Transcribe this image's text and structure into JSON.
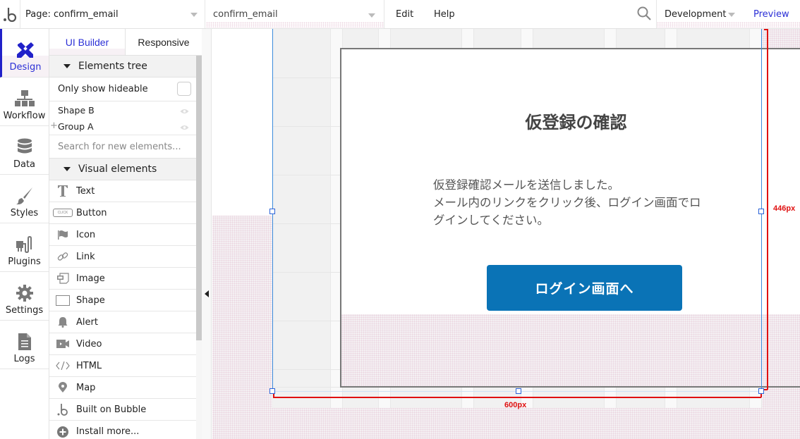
{
  "topbar": {
    "logo_icon": "bubble-logo-icon",
    "page_selector": "Page: confirm_email",
    "element_selector": "confirm_email",
    "menu": [
      {
        "label": "Edit"
      },
      {
        "label": "Help"
      }
    ],
    "search_icon": "search-icon",
    "environment": "Development",
    "preview_label": "Preview",
    "colors": {
      "preview": "#2b2fd6"
    }
  },
  "rail": {
    "items": [
      {
        "label": "Design",
        "icon": "design-tools-icon",
        "active": true
      },
      {
        "label": "Workflow",
        "icon": "workflow-icon"
      },
      {
        "label": "Data",
        "icon": "database-icon"
      },
      {
        "label": "Styles",
        "icon": "brush-icon"
      },
      {
        "label": "Plugins",
        "icon": "plug-icon"
      },
      {
        "label": "Settings",
        "icon": "gear-icon"
      },
      {
        "label": "Logs",
        "icon": "document-icon"
      }
    ],
    "colors": {
      "active": "#2121c9"
    }
  },
  "panel": {
    "tabs": [
      {
        "label": "UI Builder",
        "active": true
      },
      {
        "label": "Responsive"
      }
    ],
    "elements_tree": {
      "header": "Elements tree",
      "only_show_hideable": "Only show hideable",
      "only_show_hideable_checked": false,
      "items": [
        {
          "label": "Shape B",
          "expandable": false
        },
        {
          "label": "Group A",
          "expandable": true
        }
      ]
    },
    "search_placeholder": "Search for new elements...",
    "visual_elements": {
      "header": "Visual elements",
      "items": [
        {
          "label": "Text",
          "icon": "text-icon"
        },
        {
          "label": "Button",
          "icon": "button-icon",
          "icon_text": "CLICK"
        },
        {
          "label": "Icon",
          "icon": "flag-icon"
        },
        {
          "label": "Link",
          "icon": "link-icon"
        },
        {
          "label": "Image",
          "icon": "image-icon"
        },
        {
          "label": "Shape",
          "icon": "shape-icon"
        },
        {
          "label": "Alert",
          "icon": "bell-icon"
        },
        {
          "label": "Video",
          "icon": "video-icon"
        },
        {
          "label": "HTML",
          "icon": "code-icon"
        },
        {
          "label": "Map",
          "icon": "map-pin-icon"
        },
        {
          "label": "Built on Bubble",
          "icon": "bubble-logo-icon"
        },
        {
          "label": "Install more...",
          "icon": "plus-circle-icon"
        }
      ]
    }
  },
  "canvas": {
    "page": {
      "heading": "仮登録の確認",
      "body": "仮登録確認メールを送信しました。\nメール内のリンクをクリック後、ログイン画面でロ\nグインしてください。",
      "button_label": "ログイン画面へ",
      "colors": {
        "button": "#0a73b6",
        "heading": "#444444"
      }
    },
    "width_label": "600px",
    "height_label": "446px",
    "colors": {
      "dimension": "#e01010",
      "selection": "#3c8bdc"
    }
  }
}
